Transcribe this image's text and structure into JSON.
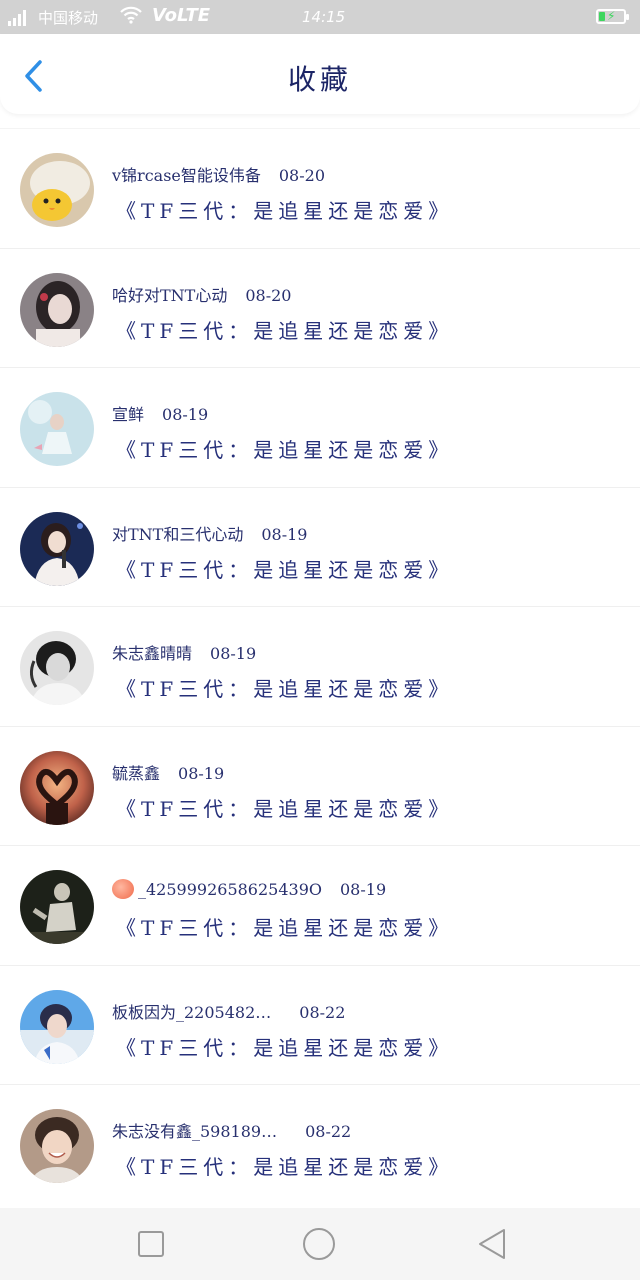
{
  "status_bar": {
    "network": "4G",
    "carrier": "中国移动",
    "volte": "VoLTE",
    "time": "14:15",
    "battery_level": 0.2,
    "charging": true,
    "battery_color": "#3ed65f"
  },
  "header": {
    "title": "收藏",
    "back_icon": "chevron-left-icon",
    "accent_color": "#2f8fe6"
  },
  "favorites": [
    {
      "author": "v锦rcase智能设伟备",
      "date": "08-20",
      "subject": "《TF三代：是追星还是恋爱》",
      "avatar": "avatar-duck"
    },
    {
      "author": "哈好对TNT心动",
      "date": "08-20",
      "subject": "《TF三代：是追星还是恋爱》",
      "avatar": "avatar-girl-bw"
    },
    {
      "author": "宣鲜",
      "date": "08-19",
      "subject": "《TF三代：是追星还是恋爱》",
      "avatar": "avatar-light-blue"
    },
    {
      "author": "对TNT和三代心动",
      "date": "08-19",
      "subject": "《TF三代：是追星还是恋爱》",
      "avatar": "avatar-singer"
    },
    {
      "author": "朱志鑫晴晴",
      "date": "08-19",
      "subject": "《TF三代：是追星还是恋爱》",
      "avatar": "avatar-bw-boy"
    },
    {
      "author": "毓蒸鑫",
      "date": "08-19",
      "subject": "《TF三代：是追星还是恋爱》",
      "avatar": "avatar-heart-hands"
    },
    {
      "author": "_4259992658625439O",
      "date": "08-19",
      "subject": "《TF三代：是追星还是恋爱》",
      "avatar": "avatar-stage",
      "has_peach_emoji": true
    },
    {
      "author": "板板因为_2205482…",
      "date": "08-22",
      "subject": "《TF三代：是追星还是恋爱》",
      "avatar": "avatar-blue-boy"
    },
    {
      "author": "朱志没有鑫_598189…",
      "date": "08-22",
      "subject": "《TF三代：是追星还是恋爱》",
      "avatar": "avatar-smile-boy"
    }
  ],
  "nav_bar": {
    "recent_icon": "square-icon",
    "home_icon": "circle-icon",
    "back_icon": "triangle-back-icon"
  }
}
